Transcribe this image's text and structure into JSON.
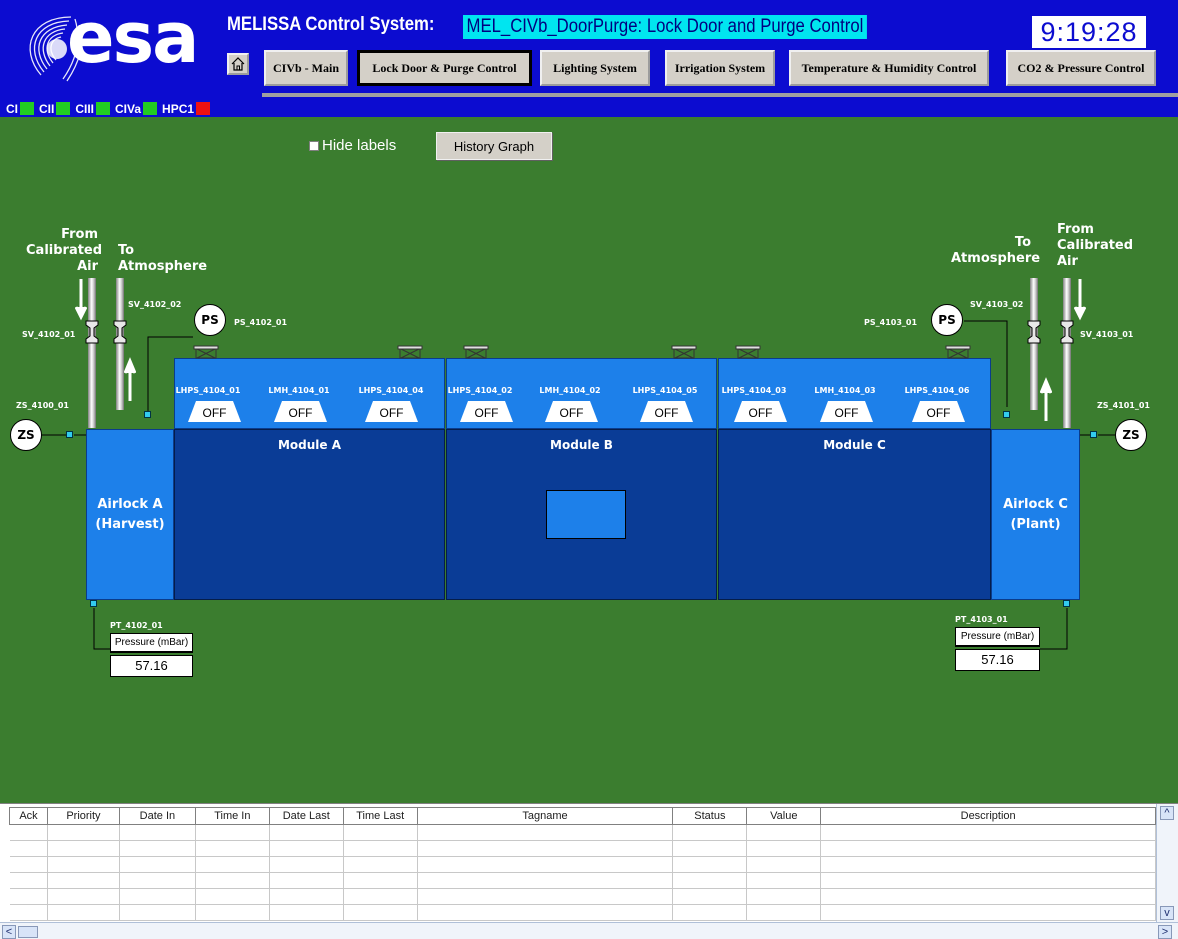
{
  "header": {
    "logo_text": "esa",
    "app_title": "MELISSA Control System:",
    "screen_title": "MEL_CIVb_DoorPurge: Lock Door and Purge Control",
    "clock": "9:19:28",
    "colors": {
      "header_bg": "#0c0cd0",
      "title_highlight": "#00e5f0",
      "main_bg": "#3b7d2f"
    }
  },
  "nav": {
    "home_icon": "house-icon",
    "buttons": [
      {
        "label": "CIVb - Main",
        "active": false
      },
      {
        "label": "Lock Door & Purge Control",
        "active": true
      },
      {
        "label": "Lighting System",
        "active": false
      },
      {
        "label": "Irrigation System",
        "active": false
      },
      {
        "label": "Temperature & Humidity Control",
        "active": false
      },
      {
        "label": "CO2 & Pressure Control",
        "active": false
      }
    ]
  },
  "status_indicators": [
    {
      "label": "CI",
      "color": "#22cc22"
    },
    {
      "label": "CII",
      "color": "#22cc22"
    },
    {
      "label": "CIII",
      "color": "#22cc22"
    },
    {
      "label": "CIVa",
      "color": "#22cc22"
    },
    {
      "label": "HPC1",
      "color": "#ee1111"
    }
  ],
  "controls": {
    "hide_labels": "Hide labels",
    "hide_labels_checked": false,
    "history_graph": "History Graph"
  },
  "left": {
    "from_air": "From\nCalibrated\nAir",
    "to_atm": "To\nAtmosphere",
    "sv_inlet": "SV_4102_01",
    "sv_outlet": "SV_4102_02",
    "ps_sensor": "PS",
    "ps_tag": "PS_4102_01",
    "zs_sensor": "ZS",
    "zs_tag": "ZS_4100_01",
    "airlock": "Airlock A\n(Harvest)",
    "pt_tag": "PT_4102_01",
    "pressure_caption": "Pressure (mBar)",
    "pressure_value": "57.16"
  },
  "right": {
    "from_air": "From\nCalibrated\nAir",
    "to_atm": "To\nAtmosphere",
    "sv_inlet": "SV_4103_01",
    "sv_outlet": "SV_4103_02",
    "ps_sensor": "PS",
    "ps_tag": "PS_4103_01",
    "zs_sensor": "ZS",
    "zs_tag": "ZS_4101_01",
    "airlock": "Airlock C\n(Plant)",
    "pt_tag": "PT_4103_01",
    "pressure_caption": "Pressure (mBar)",
    "pressure_value": "57.16"
  },
  "modules": [
    {
      "name": "Module A",
      "lamps": [
        {
          "tag": "LHPS_4104_01",
          "state": "OFF"
        },
        {
          "tag": "LMH_4104_01",
          "state": "OFF"
        },
        {
          "tag": "LHPS_4104_04",
          "state": "OFF"
        }
      ]
    },
    {
      "name": "Module B",
      "lamps": [
        {
          "tag": "LHPS_4104_02",
          "state": "OFF"
        },
        {
          "tag": "LMH_4104_02",
          "state": "OFF"
        },
        {
          "tag": "LHPS_4104_05",
          "state": "OFF"
        }
      ]
    },
    {
      "name": "Module C",
      "lamps": [
        {
          "tag": "LHPS_4104_03",
          "state": "OFF"
        },
        {
          "tag": "LMH_4104_03",
          "state": "OFF"
        },
        {
          "tag": "LHPS_4104_06",
          "state": "OFF"
        }
      ]
    }
  ],
  "alarm_table": {
    "columns": [
      "Ack",
      "Priority",
      "Date In",
      "Time In",
      "Date Last",
      "Time Last",
      "Tagname",
      "Status",
      "Value",
      "Description"
    ],
    "rows": []
  }
}
